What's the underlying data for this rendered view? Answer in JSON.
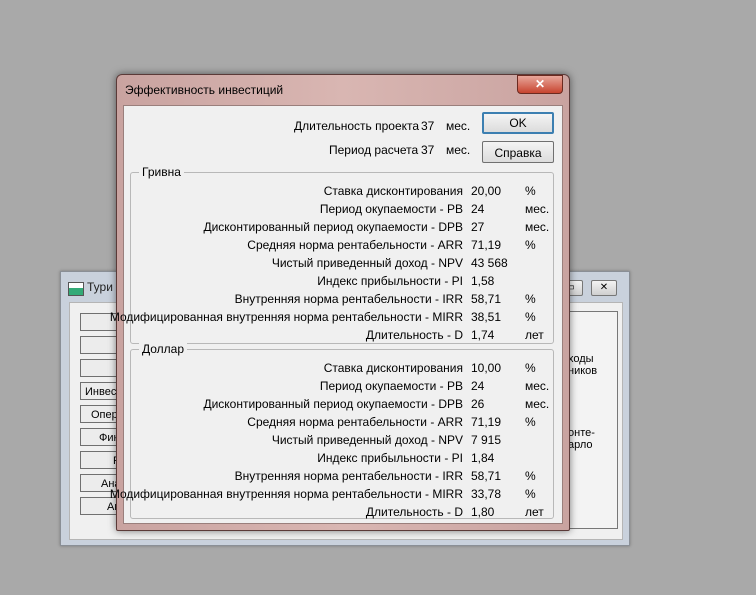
{
  "background_window": {
    "title": "Тури",
    "buttons": [
      "",
      "",
      "С",
      "Инвест",
      "Опер",
      "Фин",
      "R",
      "Ана",
      "Ак"
    ],
    "right_text_1": [
      "ходы",
      "ников"
    ],
    "right_text_2": [
      "онте-",
      "арло"
    ]
  },
  "dialog": {
    "title": "Эффективность инвестиций",
    "close_label": "✕",
    "project_duration_label": "Длительность проекта",
    "project_duration_value": "37",
    "project_duration_unit": "мес.",
    "calc_period_label": "Период расчета",
    "calc_period_value": "37",
    "calc_period_unit": "мес.",
    "ok_label": "OK",
    "help_label": "Справка"
  },
  "groups": [
    {
      "title": "Гривна",
      "rows": [
        {
          "label": "Ставка дисконтирования",
          "value": "20,00",
          "unit": "%"
        },
        {
          "label": "Период окупаемости - PB",
          "value": "24",
          "unit": "мес."
        },
        {
          "label": "Дисконтированный период окупаемости - DPB",
          "value": "27",
          "unit": "мес."
        },
        {
          "label": "Средняя норма рентабельности - ARR",
          "value": "71,19",
          "unit": "%"
        },
        {
          "label": "Чистый приведенный доход - NPV",
          "value": "43 568",
          "unit": ""
        },
        {
          "label": "Индекс прибыльности - PI",
          "value": "1,58",
          "unit": ""
        },
        {
          "label": "Внутренняя норма рентабельности - IRR",
          "value": "58,71",
          "unit": "%"
        },
        {
          "label": "Модифицированная внутренняя норма рентабельности - MIRR",
          "value": "38,51",
          "unit": "%"
        },
        {
          "label": "Длительность - D",
          "value": "1,74",
          "unit": "лет"
        }
      ]
    },
    {
      "title": "Доллар",
      "rows": [
        {
          "label": "Ставка дисконтирования",
          "value": "10,00",
          "unit": "%"
        },
        {
          "label": "Период окупаемости - PB",
          "value": "24",
          "unit": "мес."
        },
        {
          "label": "Дисконтированный период окупаемости - DPB",
          "value": "26",
          "unit": "мес."
        },
        {
          "label": "Средняя норма рентабельности - ARR",
          "value": "71,19",
          "unit": "%"
        },
        {
          "label": "Чистый приведенный доход - NPV",
          "value": "7 915",
          "unit": ""
        },
        {
          "label": "Индекс прибыльности - PI",
          "value": "1,84",
          "unit": ""
        },
        {
          "label": "Внутренняя норма рентабельности - IRR",
          "value": "58,71",
          "unit": "%"
        },
        {
          "label": "Модифицированная внутренняя норма рентабельности - MIRR",
          "value": "33,78",
          "unit": "%"
        },
        {
          "label": "Длительность - D",
          "value": "1,80",
          "unit": "лет"
        }
      ]
    }
  ]
}
